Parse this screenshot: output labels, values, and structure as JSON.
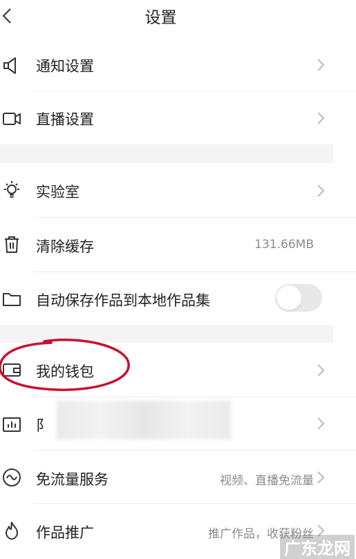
{
  "header": {
    "title": "设置"
  },
  "rows": {
    "notify": {
      "label": "通知设置"
    },
    "live": {
      "label": "直播设置"
    },
    "lab": {
      "label": "实验室"
    },
    "cache": {
      "label": "清除缓存",
      "value": "131.66MB"
    },
    "autosave": {
      "label": "自动保存作品到本地作品集",
      "toggle_on": false
    },
    "wallet": {
      "label": "我的钱包"
    },
    "hidden": {
      "label": "阝"
    },
    "freeflow": {
      "label": "免流量服务",
      "value": "视频、直播免流量"
    },
    "promote": {
      "label": "作品推广",
      "value": "推广作品，收获粉丝"
    }
  },
  "watermark": {
    "text": "广东龙网"
  },
  "colors": {
    "annotation": "#c8102e",
    "separator": "#f4f4f4",
    "muted_text": "#8a8a8a"
  }
}
